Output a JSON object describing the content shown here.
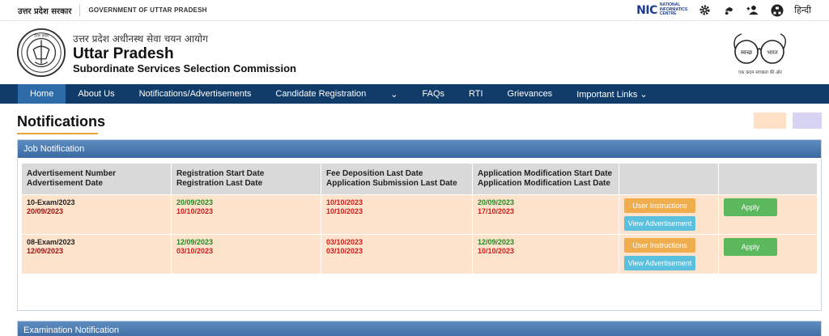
{
  "topbar": {
    "gov_hindi": "उत्तर प्रदेश सरकार",
    "gov_english": "GOVERNMENT OF UTTAR PRADESH",
    "nic_mark": "NIC",
    "nic_text": [
      "NATIONAL",
      "INFORMATICS",
      "CENTRE"
    ],
    "language_toggle": "हिन्दी",
    "icons": [
      "gear-icon",
      "accessibility-icon",
      "users-icon",
      "sitemap-icon"
    ]
  },
  "header": {
    "title_hindi": "उत्तर प्रदेश अधीनस्थ सेवा चयन आयोग",
    "title_main": "Uttar Pradesh",
    "title_sub": "Subordinate Services Selection Commission",
    "emblem_text": "उत्तर प्रदेश",
    "swachh_left": "स्वच्छ",
    "swachh_right": "भारत",
    "swachh_tagline": "एक कदम स्वच्छता की ओर"
  },
  "nav": {
    "items": [
      {
        "label": "Home",
        "active": true
      },
      {
        "label": "About Us"
      },
      {
        "label": "Notifications/Advertisements"
      },
      {
        "label": "Candidate Registration"
      },
      {
        "label": "⌄"
      },
      {
        "label": "FAQs"
      },
      {
        "label": "RTI"
      },
      {
        "label": "Grievances"
      },
      {
        "label": "Important Links ⌄"
      }
    ]
  },
  "page": {
    "title": "Notifications",
    "accent": "#e8a33a"
  },
  "job_panel": {
    "title": "Job Notification",
    "columns": [
      [
        "Advertisement Number",
        "Advertisement Date"
      ],
      [
        "Registration Start Date",
        "Registration Last Date"
      ],
      [
        "Fee Deposition Last Date",
        "Application Submission Last Date"
      ],
      [
        "Application Modification Start Date",
        "Application Modification Last Date"
      ],
      [
        ""
      ],
      [
        ""
      ]
    ],
    "rows": [
      {
        "adv_number": "10-Exam/2023",
        "adv_date": "20/09/2023",
        "reg_start": "20/09/2023",
        "reg_last": "10/10/2023",
        "fee_last": "10/10/2023",
        "submission_last": "10/10/2023",
        "mod_start": "20/09/2023",
        "mod_last": "17/10/2023",
        "btn_instructions": "User Instructions",
        "btn_view": "View Advertisement",
        "btn_apply": "Apply"
      },
      {
        "adv_number": "08-Exam/2023",
        "adv_date": "12/09/2023",
        "reg_start": "12/09/2023",
        "reg_last": "03/10/2023",
        "fee_last": "03/10/2023",
        "submission_last": "03/10/2023",
        "mod_start": "12/09/2023",
        "mod_last": "10/10/2023",
        "btn_instructions": "User Instructions",
        "btn_view": "View Advertisement",
        "btn_apply": "Apply"
      }
    ]
  },
  "exam_panel": {
    "title": "Examination Notification"
  },
  "colors": {
    "nav_bg": "#113c6a",
    "nav_active": "#2c6aa8",
    "row_bg": "#fde3cb",
    "green": "#1f8a1f",
    "red": "#d01a1a",
    "btn_orange": "#f0ad4e",
    "btn_blue": "#5bc0de",
    "btn_green": "#5cb85c"
  }
}
